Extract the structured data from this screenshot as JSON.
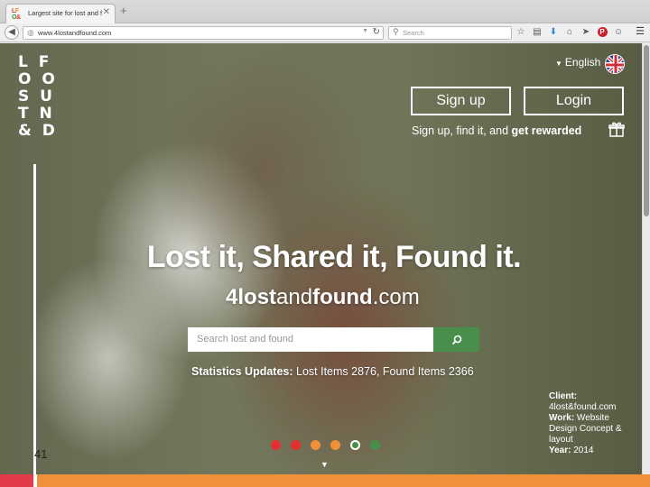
{
  "browser": {
    "tab": {
      "title": "Largest site for lost and fou...",
      "favicon_letters": [
        "L",
        "F",
        "O",
        "&"
      ]
    },
    "url": "www.4lostandfound.com",
    "search_placeholder": "Search"
  },
  "header": {
    "logo_rows": [
      "L F",
      "O O",
      "S U",
      "T N",
      "& D"
    ],
    "language": "English",
    "signup_label": "Sign up",
    "login_label": "Login",
    "reward_text": "Sign up, find it, and ",
    "reward_strong": "get rewarded"
  },
  "hero": {
    "title": "Lost it, Shared it, Found it.",
    "domain_parts": [
      "4",
      "lost",
      "and",
      "found",
      ".com"
    ],
    "search_placeholder": "Search lost and found",
    "stats_label": "Statistics Updates:",
    "stats_value": " Lost Items 2876, Found Items 2366"
  },
  "slider": {
    "dots": [
      {
        "color": "#e2302f",
        "active": false
      },
      {
        "color": "#e2302f",
        "active": false
      },
      {
        "color": "#f0903a",
        "active": false
      },
      {
        "color": "#f0903a",
        "active": false
      },
      {
        "color": "#4a8e4b",
        "active": true
      },
      {
        "color": "#4a8e4b",
        "active": false
      }
    ]
  },
  "client_info": {
    "client_label": "Client:",
    "client_value": "4lost&found.com",
    "work_label": "Work:",
    "work_value": " Website Design Concept & layout",
    "year_label": "Year:",
    "year_value": " 2014"
  },
  "page_number": "41",
  "colors": {
    "red": "#e23b4a",
    "orange": "#f0903a",
    "green": "#4a8e4b"
  },
  "icons": [
    "back-arrow-icon",
    "globe-icon",
    "reload-icon",
    "search-icon",
    "star-icon",
    "clipboard-icon",
    "download-icon",
    "home-icon",
    "send-icon",
    "pinterest-icon",
    "chat-icon",
    "menu-icon",
    "uk-flag-icon",
    "gift-icon"
  ]
}
